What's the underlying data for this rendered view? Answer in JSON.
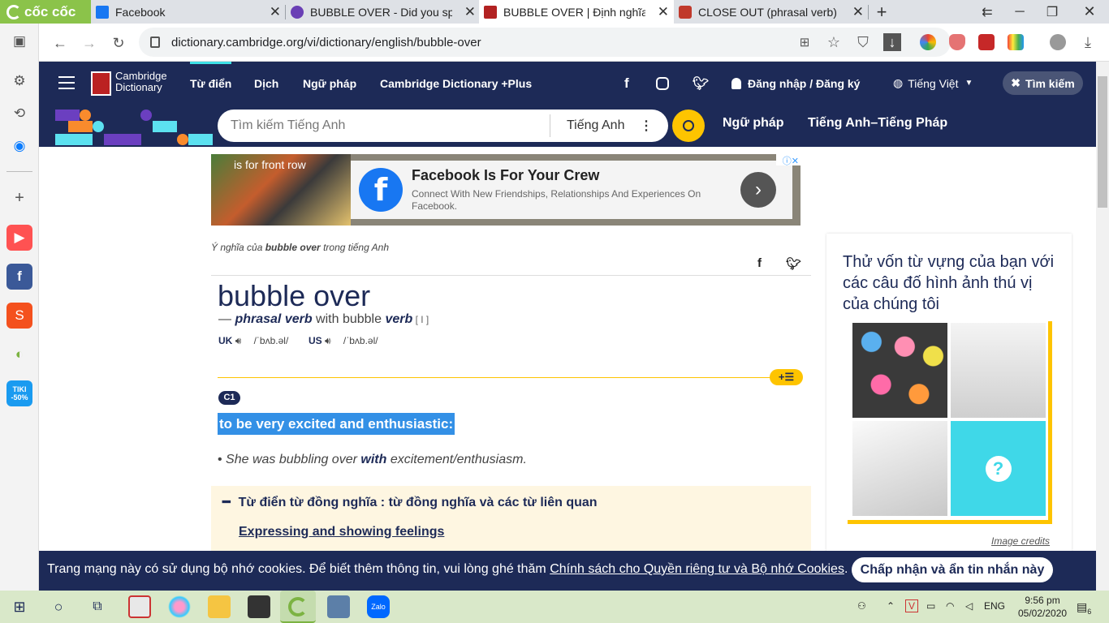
{
  "browser": {
    "brand": "cốc cốc",
    "tabs": [
      {
        "title": "Facebook",
        "color": "#1877f2"
      },
      {
        "title": "BUBBLE OVER - Did you spell",
        "color": "#6a3fb5"
      },
      {
        "title": "BUBBLE OVER | Định nghĩa tro",
        "color": "#b22222"
      },
      {
        "title": "CLOSE OUT (phrasal verb) def",
        "color": "#c0392b"
      }
    ],
    "new_tab": "+",
    "url": "dictionary.cambridge.org/vi/dictionary/english/bubble-over"
  },
  "site": {
    "brand_line1": "Cambridge",
    "brand_line2": "Dictionary",
    "nav": [
      "Từ điển",
      "Dịch",
      "Ngữ pháp",
      "Cambridge Dictionary +Plus"
    ],
    "signin": "Đăng nhập / Đăng ký",
    "language": "Tiếng Việt",
    "search_toggle": "Tìm kiếm",
    "search_placeholder": "Tìm kiếm Tiếng Anh",
    "search_lang": "Tiếng Anh",
    "sub_links": [
      "Ngữ pháp",
      "Tiếng Anh–Tiếng Pháp"
    ]
  },
  "ad": {
    "overlay": "is for front row",
    "title": "Facebook Is For Your Crew",
    "desc": "Connect With New Friendships, Relationships And Experiences On Facebook."
  },
  "entry": {
    "meaning_prefix": "Ý nghĩa của ",
    "meaning_word": "bubble over",
    "meaning_suffix": " trong tiếng Anh",
    "headword": "bubble over",
    "dash": "— ",
    "pos": "phrasal verb",
    "with": " with bubble ",
    "verb": "verb",
    "gram": " [ I ]",
    "uk": "UK",
    "uk_ipa": "/ˈbʌb.əl/",
    "us": "US",
    "us_ipa": "/ˈbʌb.əl/",
    "level": "C1",
    "definition": "to be very excited and enthusiastic:",
    "example_pre": "She was bubbling over ",
    "example_bold": "with",
    "example_post": " excitement/enthusiasm.",
    "thes_heading": "Từ điển từ đồng nghĩa : từ đồng nghĩa và các từ liên quan",
    "thes_link": "Expressing and showing feelings"
  },
  "quiz": {
    "heading": "Thử vốn từ vựng của bạn với các câu đố hình ảnh thú vị của chúng tôi",
    "credits": "Image credits"
  },
  "cookie": {
    "text": "Trang mạng này có sử dụng bộ nhớ cookies. Để biết thêm thông tin, vui lòng ghé thăm ",
    "link": "Chính sách cho Quyền riêng tư và Bộ nhớ Cookies",
    "tail": ".",
    "button": "Chấp nhận và ẩn tin nhắn này"
  },
  "taskbar": {
    "lang": "ENG",
    "time": "9:56 pm",
    "date": "05/02/2020",
    "notif_count": "6"
  }
}
